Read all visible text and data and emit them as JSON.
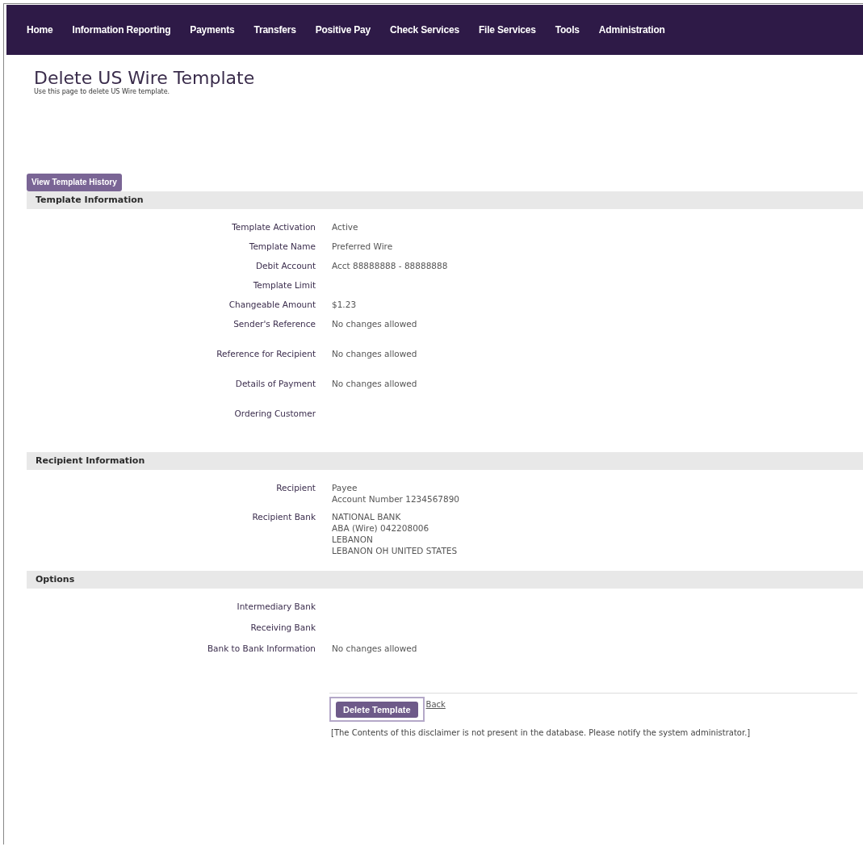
{
  "nav": [
    {
      "label": "Home"
    },
    {
      "label": "Information Reporting"
    },
    {
      "label": "Payments"
    },
    {
      "label": "Transfers"
    },
    {
      "label": "Positive Pay"
    },
    {
      "label": "Check Services"
    },
    {
      "label": "File Services"
    },
    {
      "label": "Tools"
    },
    {
      "label": "Administration"
    }
  ],
  "page": {
    "title": "Delete US Wire Template",
    "subtitle": "Use this page to delete US Wire template."
  },
  "history_button": "View Template History",
  "sections": [
    {
      "title": "Template Information",
      "rows": [
        {
          "label": "Template Activation",
          "lines": [
            "Active"
          ]
        },
        {
          "label": "Template Name",
          "lines": [
            "Preferred Wire"
          ]
        },
        {
          "label": "Debit Account",
          "lines": [
            "Acct 88888888 - 88888888"
          ]
        },
        {
          "label": "Template Limit"
        },
        {
          "label": "Changeable Amount",
          "lines": [
            "$1.23"
          ]
        },
        {
          "label": "Sender's Reference",
          "lines": [
            "No changes allowed"
          ]
        },
        {
          "label": "Reference for Recipient",
          "lines": [
            "No changes allowed"
          ]
        },
        {
          "label": "Details of Payment",
          "lines": [
            "No changes allowed"
          ]
        },
        {
          "label": "Ordering Customer"
        }
      ]
    },
    {
      "title": "Recipient Information",
      "rows": [
        {
          "label": "Recipient",
          "lines": [
            "Payee",
            "Account Number 1234567890"
          ]
        },
        {
          "label": "Recipient Bank",
          "lines": [
            "NATIONAL BANK",
            "ABA (Wire) 042208006",
            "LEBANON",
            "LEBANON OH UNITED STATES"
          ]
        }
      ]
    },
    {
      "title": "Options",
      "rows": [
        {
          "label": "Intermediary Bank"
        },
        {
          "label": "Receiving Bank"
        },
        {
          "label": "Bank to Bank Information",
          "lines": [
            "No changes allowed"
          ]
        }
      ]
    }
  ],
  "actions": {
    "delete_button": "Delete Template",
    "back_link": "Back"
  },
  "disclaimer": "[The Contents of this disclaimer is not present in the database. Please notify the system administrator.]"
}
